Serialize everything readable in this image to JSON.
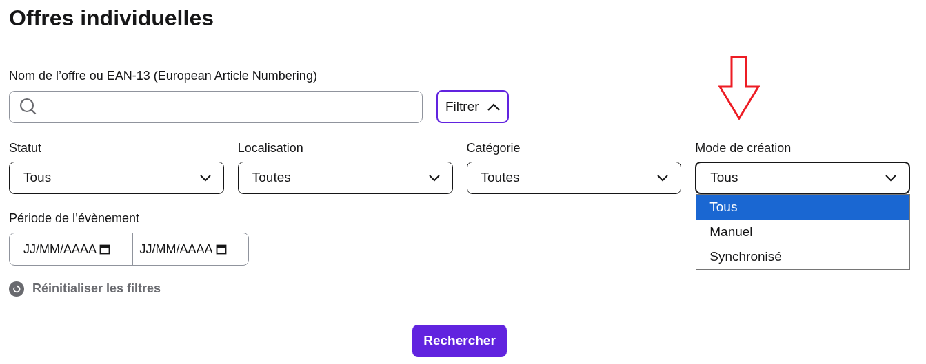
{
  "title": "Offres individuelles",
  "search": {
    "label": "Nom de l’offre ou EAN-13 (European Article Numbering)"
  },
  "filter_button": {
    "label": "Filtrer",
    "expanded": true
  },
  "selects": [
    {
      "label": "Statut",
      "value": "Tous",
      "open": false
    },
    {
      "label": "Localisation",
      "value": "Toutes",
      "open": false
    },
    {
      "label": "Catégorie",
      "value": "Toutes",
      "open": false
    },
    {
      "label": "Mode de création",
      "value": "Tous",
      "open": true,
      "options": [
        {
          "label": "Tous",
          "selected": true
        },
        {
          "label": "Manuel",
          "selected": false
        },
        {
          "label": "Synchronisé",
          "selected": false
        }
      ]
    }
  ],
  "period": {
    "label": "Période de l’évènement",
    "start": "JJ/MM/AAAA",
    "end": "JJ/MM/AAAA"
  },
  "reset_link": "Réinitialiser les filtres",
  "submit_button": "Rechercher"
}
